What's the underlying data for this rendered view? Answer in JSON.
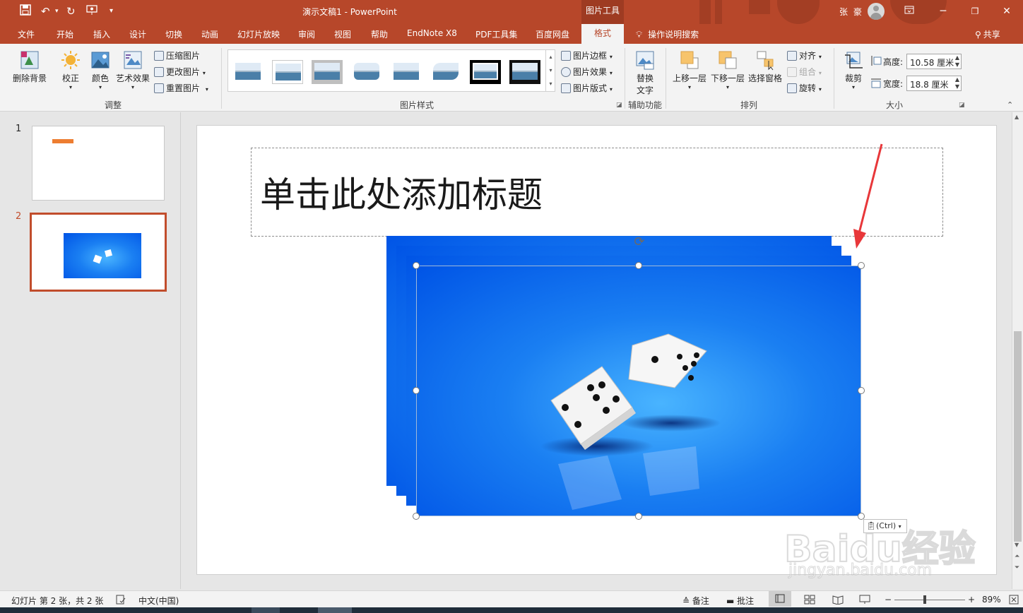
{
  "titlebar": {
    "doc_title": "演示文稿1  -  PowerPoint",
    "context_tools": "图片工具",
    "user": "张 豪"
  },
  "tabs": [
    "文件",
    "开始",
    "插入",
    "设计",
    "切换",
    "动画",
    "幻灯片放映",
    "审阅",
    "视图",
    "帮助",
    "EndNote X8",
    "PDF工具集",
    "百度网盘"
  ],
  "active_tab": "格式",
  "tellme": "操作说明搜索",
  "share": "共享",
  "ribbon": {
    "adjust": {
      "remove_bg": "删除背景",
      "corrections": "校正",
      "color": "颜色",
      "artistic": "艺术效果",
      "compress": "压缩图片",
      "change": "更改图片",
      "reset": "重置图片",
      "label": "调整"
    },
    "styles": {
      "border": "图片边框",
      "effects": "图片效果",
      "layout": "图片版式",
      "label": "图片样式"
    },
    "accessibility": {
      "alt_text_1": "替换",
      "alt_text_2": "文字",
      "label": "辅助功能"
    },
    "arrange": {
      "bring_forward": "上移一层",
      "send_backward": "下移一层",
      "selection_pane": "选择窗格",
      "align": "对齐",
      "group": "组合",
      "rotate": "旋转",
      "label": "排列"
    },
    "size": {
      "crop": "裁剪",
      "height_label": "高度:",
      "height_value": "10.58 厘米",
      "width_label": "宽度:",
      "width_value": "18.8 厘米",
      "label": "大小"
    }
  },
  "slides": [
    {
      "number": "1"
    },
    {
      "number": "2"
    }
  ],
  "slide": {
    "title_placeholder": "单击此处添加标题"
  },
  "paste_options": "(Ctrl)",
  "status": {
    "slide_info": "幻灯片 第 2 张，共 2 张",
    "language": "中文(中国)",
    "notes": "备注",
    "comments": "批注",
    "zoom": "89%"
  },
  "watermark": {
    "brand": "Baidu经验",
    "url": "jingyan.baidu.com"
  },
  "colors": {
    "accent": "#b7472a",
    "image_blue": "#0054e6"
  }
}
